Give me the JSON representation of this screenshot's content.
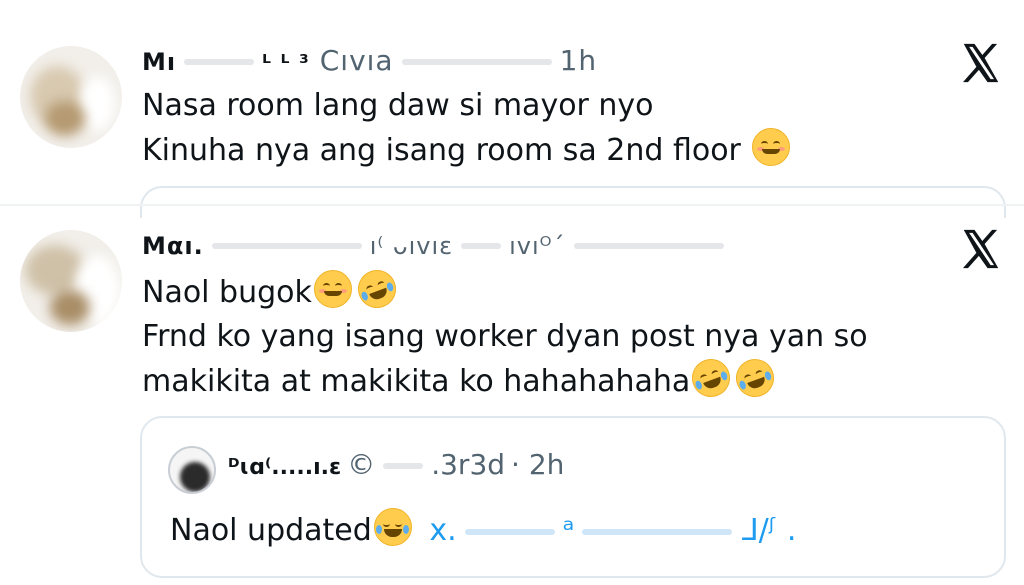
{
  "posts": [
    {
      "header_name": "M’˞·••• ••••˜• •••••••••••••••••••••••••••••••••••••••••••••••••••••••••••••••••••••••••••••••",
      "time": "1h",
      "lines": [
        "Nasa room lang daw si mayor nyo",
        "Kinuha nya ang isang room sa 2nd floor"
      ]
    },
    {
      "time": "",
      "lines": [
        "Naol bugok",
        "Frnd ko yang isang worker dyan post nya yan so",
        "makikita at makikita ko hahahahaha"
      ]
    }
  ],
  "quote": {
    "time": "· 2h",
    "handle_tail": ".3r3d",
    "text": "Naol updated",
    "link": "x."
  },
  "icons": {
    "close": "x-logo-icon"
  },
  "colors": {
    "text": "#0f1419",
    "secondary": "#536471",
    "link": "#1d9bf0",
    "emoji": "#ffcc4d"
  }
}
